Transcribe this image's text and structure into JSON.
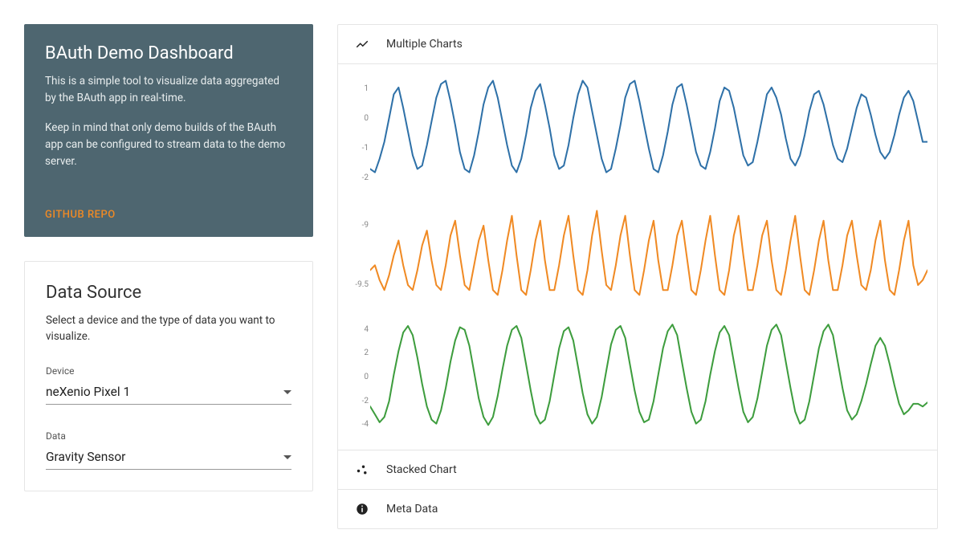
{
  "hero": {
    "title": "BAuth Demo Dashboard",
    "p1": "This is a simple tool to visualize data aggregated by the BAuth app in real-time.",
    "p2": "Keep in mind that only demo builds of the BAuth app can be configured to stream data to the demo server.",
    "repo_label": "GITHUB REPO"
  },
  "datasource": {
    "title": "Data Source",
    "desc": "Select a device and the type of data you want to visualize.",
    "device_label": "Device",
    "device_value": "neXenio Pixel 1",
    "data_label": "Data",
    "data_value": "Gravity Sensor"
  },
  "panels": {
    "multiple": "Multiple Charts",
    "stacked": "Stacked Chart",
    "meta": "Meta Data"
  },
  "colors": {
    "series1": "#2f71a8",
    "series2": "#f08a24",
    "series3": "#3e9d3e"
  },
  "chart_data": [
    {
      "type": "line",
      "name": "series1",
      "color": "#2f71a8",
      "ylabels": [
        "1",
        "0",
        "-1",
        "-2"
      ],
      "ylim": [
        -2,
        1.5
      ],
      "values": [
        -1.3,
        -1.4,
        -1.0,
        -0.5,
        0.2,
        0.9,
        1.1,
        0.5,
        -0.2,
        -0.9,
        -1.3,
        -1.2,
        -0.6,
        0.1,
        0.8,
        1.2,
        1.3,
        0.7,
        0.0,
        -0.8,
        -1.3,
        -1.4,
        -0.9,
        -0.2,
        0.6,
        1.1,
        1.3,
        0.8,
        0.1,
        -0.6,
        -1.2,
        -1.4,
        -1.0,
        -0.3,
        0.5,
        1.0,
        1.2,
        0.6,
        -0.1,
        -0.9,
        -1.3,
        -1.2,
        -0.6,
        0.2,
        0.9,
        1.3,
        1.1,
        0.4,
        -0.3,
        -1.0,
        -1.4,
        -1.3,
        -0.7,
        0.0,
        0.8,
        1.2,
        1.3,
        0.7,
        0.0,
        -0.7,
        -1.3,
        -1.4,
        -0.9,
        -0.2,
        0.6,
        1.1,
        1.2,
        0.6,
        -0.1,
        -0.8,
        -1.2,
        -1.3,
        -0.8,
        -0.1,
        0.7,
        1.1,
        1.0,
        0.5,
        -0.2,
        -0.9,
        -1.2,
        -1.1,
        -0.5,
        0.2,
        0.9,
        1.1,
        0.8,
        0.3,
        -0.4,
        -1.0,
        -1.2,
        -0.9,
        -0.3,
        0.4,
        0.9,
        1.0,
        0.6,
        0.0,
        -0.6,
        -1.0,
        -1.1,
        -0.7,
        -0.1,
        0.5,
        0.9,
        0.8,
        0.3,
        -0.3,
        -0.8,
        -1.0,
        -0.8,
        -0.3,
        0.3,
        0.8,
        1.0,
        0.7,
        0.1,
        -0.5,
        -0.5
      ]
    },
    {
      "type": "line",
      "name": "series2",
      "color": "#f08a24",
      "ylabels": [
        "-9",
        "-9.5"
      ],
      "ylim": [
        -9.8,
        -8.6
      ],
      "values": [
        -9.35,
        -9.3,
        -9.45,
        -9.55,
        -9.4,
        -9.2,
        -9.05,
        -9.3,
        -9.5,
        -9.55,
        -9.35,
        -9.1,
        -8.95,
        -9.25,
        -9.5,
        -9.55,
        -9.3,
        -9.0,
        -8.85,
        -9.2,
        -9.5,
        -9.55,
        -9.3,
        -9.05,
        -8.9,
        -9.25,
        -9.55,
        -9.6,
        -9.35,
        -9.05,
        -8.8,
        -9.2,
        -9.55,
        -9.6,
        -9.35,
        -9.05,
        -8.85,
        -9.25,
        -9.55,
        -9.55,
        -9.3,
        -9.0,
        -8.8,
        -9.2,
        -9.55,
        -9.6,
        -9.35,
        -9.0,
        -8.75,
        -9.15,
        -9.5,
        -9.55,
        -9.3,
        -9.0,
        -8.8,
        -9.2,
        -9.55,
        -9.6,
        -9.35,
        -9.05,
        -8.85,
        -9.25,
        -9.55,
        -9.55,
        -9.3,
        -9.0,
        -8.85,
        -9.2,
        -9.55,
        -9.6,
        -9.35,
        -9.05,
        -8.8,
        -9.2,
        -9.55,
        -9.6,
        -9.35,
        -9.0,
        -8.8,
        -9.2,
        -9.55,
        -9.55,
        -9.3,
        -9.0,
        -8.85,
        -9.25,
        -9.55,
        -9.6,
        -9.35,
        -9.05,
        -8.8,
        -9.2,
        -9.55,
        -9.6,
        -9.35,
        -9.05,
        -8.85,
        -9.25,
        -9.55,
        -9.55,
        -9.3,
        -9.0,
        -8.85,
        -9.2,
        -9.5,
        -9.55,
        -9.35,
        -9.05,
        -8.85,
        -9.25,
        -9.55,
        -9.6,
        -9.35,
        -9.05,
        -8.85,
        -9.3,
        -9.5,
        -9.45,
        -9.35
      ]
    },
    {
      "type": "line",
      "name": "series3",
      "color": "#3e9d3e",
      "ylabels": [
        "4",
        "2",
        "0",
        "-2",
        "-4"
      ],
      "ylim": [
        -4.5,
        4.5
      ],
      "values": [
        -2.2,
        -2.8,
        -3.4,
        -3.0,
        -1.8,
        0.2,
        2.0,
        3.4,
        3.9,
        3.2,
        1.5,
        -0.5,
        -2.2,
        -3.2,
        -3.5,
        -2.5,
        -0.8,
        1.2,
        2.8,
        3.8,
        3.6,
        2.4,
        0.4,
        -1.6,
        -3.0,
        -3.6,
        -3.0,
        -1.4,
        0.6,
        2.4,
        3.6,
        3.9,
        3.0,
        1.0,
        -1.0,
        -2.8,
        -3.5,
        -3.2,
        -1.8,
        0.2,
        2.2,
        3.5,
        3.8,
        2.8,
        0.8,
        -1.2,
        -2.8,
        -3.5,
        -3.0,
        -1.5,
        0.5,
        2.5,
        3.6,
        3.9,
        3.0,
        1.0,
        -1.0,
        -2.6,
        -3.4,
        -3.2,
        -1.8,
        0.2,
        2.2,
        3.5,
        4.0,
        3.2,
        1.2,
        -0.8,
        -2.6,
        -3.5,
        -3.2,
        -1.8,
        0.2,
        2.0,
        3.4,
        3.9,
        3.2,
        1.2,
        -0.8,
        -2.6,
        -3.4,
        -3.0,
        -1.6,
        0.4,
        2.4,
        3.6,
        4.0,
        3.2,
        1.2,
        -0.8,
        -2.6,
        -3.5,
        -3.2,
        -1.8,
        0.2,
        2.2,
        3.5,
        4.0,
        3.2,
        1.2,
        -0.8,
        -2.5,
        -3.2,
        -2.8,
        -1.8,
        -0.5,
        1.0,
        2.4,
        3.0,
        2.4,
        1.0,
        -0.6,
        -2.0,
        -2.8,
        -2.5,
        -2.0,
        -2.0,
        -2.2,
        -1.9
      ]
    }
  ]
}
